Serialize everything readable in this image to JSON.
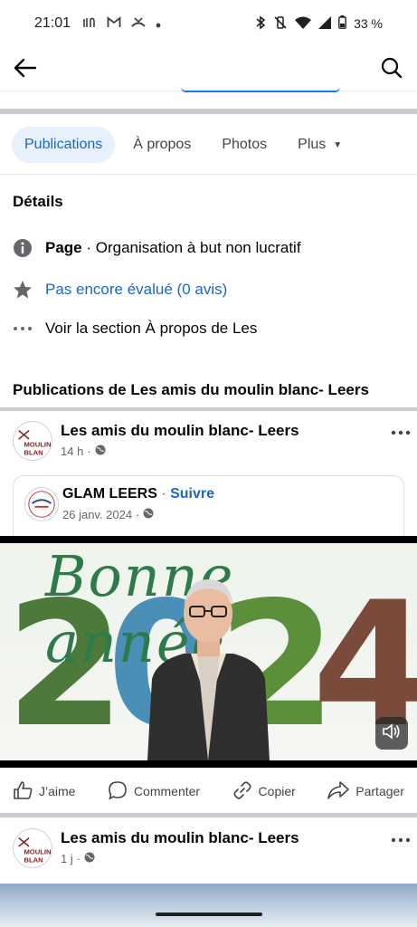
{
  "status_bar": {
    "time": "21:01",
    "battery": "33 %",
    "left_icons": [
      "signal-app-icon",
      "gmail-icon",
      "missed-call-icon",
      "dot-icon"
    ],
    "right_icons": [
      "bluetooth-icon",
      "vibrate-off-icon",
      "wifi-icon",
      "cell-signal-icon",
      "battery-icon"
    ]
  },
  "top_bar": {
    "back_icon": "arrow-left-icon",
    "search_icon": "search-icon"
  },
  "tabs": [
    {
      "label": "Publications",
      "active": true
    },
    {
      "label": "À propos",
      "active": false
    },
    {
      "label": "Photos",
      "active": false
    },
    {
      "label": "Plus",
      "active": false
    }
  ],
  "details": {
    "title": "Détails",
    "category_label": "Page",
    "category_value": " · Organisation à but non lucratif",
    "rating": "Pas encore évalué (0 avis)",
    "about_link": "Voir la section À propos de Les"
  },
  "publications_title": "Publications de Les amis du moulin blanc- Leers",
  "posts": [
    {
      "author": "Les amis du moulin blanc- Leers",
      "time": "14 h",
      "shared": {
        "author": "GLAM LEERS",
        "follow": "Suivre",
        "separator": " · ",
        "date": "26 janv. 2024"
      },
      "video": {
        "title_text": "Bonne année",
        "year_digits": [
          "2",
          "0",
          "2",
          "4"
        ]
      }
    },
    {
      "author": "Les amis du moulin blanc- Leers",
      "time": "1 j"
    }
  ],
  "avatar_text": {
    "line1": "MOULIN",
    "line2": "BLAN"
  },
  "actions": [
    {
      "label": "J’aime",
      "icon": "thumbs-up-icon"
    },
    {
      "label": "Commenter",
      "icon": "comment-icon"
    },
    {
      "label": "Copier",
      "icon": "link-icon"
    },
    {
      "label": "Partager",
      "icon": "share-icon"
    }
  ],
  "colors": {
    "accent": "#1b66c9",
    "tab_active_bg": "#e7f0fd",
    "muted": "#65676b"
  }
}
